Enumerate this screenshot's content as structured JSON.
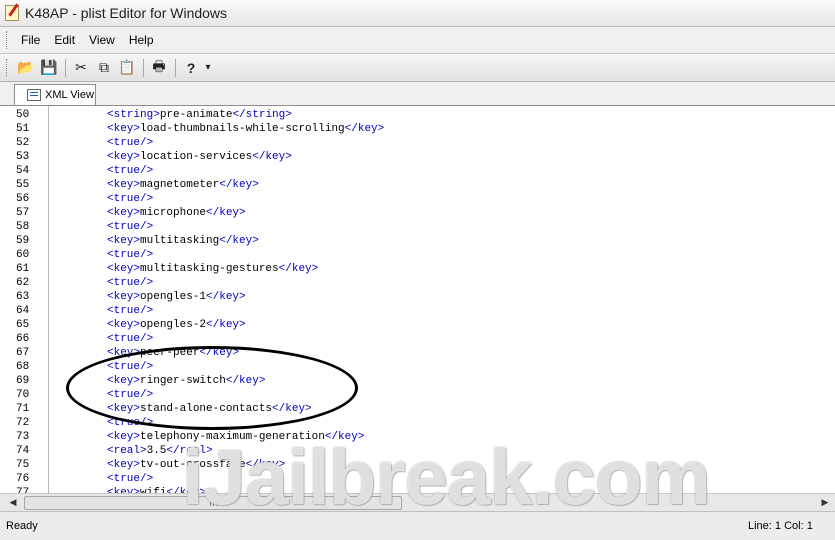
{
  "window": {
    "title": "K48AP - plist Editor for Windows"
  },
  "menu": [
    "File",
    "Edit",
    "View",
    "Help"
  ],
  "toolbar": {
    "buttons": [
      {
        "name": "open-icon",
        "glyph": "📂"
      },
      {
        "name": "save-icon",
        "glyph": "💾"
      },
      {
        "name": "cut-icon",
        "glyph": "✂"
      },
      {
        "name": "copy-icon",
        "glyph": "⧉"
      },
      {
        "name": "paste-icon",
        "glyph": "📋"
      },
      {
        "name": "print-icon",
        "glyph": "🖶"
      },
      {
        "name": "help-icon",
        "glyph": "?"
      }
    ],
    "dropdown_glyph": "▾"
  },
  "tabs": [
    {
      "label": "XML View"
    }
  ],
  "editor": {
    "lines": [
      {
        "n": "50",
        "tag": "string",
        "text": "pre-animate"
      },
      {
        "n": "51",
        "tag": "key",
        "text": "load-thumbnails-while-scrolling"
      },
      {
        "n": "52",
        "tag": "true/"
      },
      {
        "n": "53",
        "tag": "key",
        "text": "location-services"
      },
      {
        "n": "54",
        "tag": "true/"
      },
      {
        "n": "55",
        "tag": "key",
        "text": "magnetometer"
      },
      {
        "n": "56",
        "tag": "true/"
      },
      {
        "n": "57",
        "tag": "key",
        "text": "microphone"
      },
      {
        "n": "58",
        "tag": "true/"
      },
      {
        "n": "59",
        "tag": "key",
        "text": "multitasking"
      },
      {
        "n": "60",
        "tag": "true/"
      },
      {
        "n": "61",
        "tag": "key",
        "text": "multitasking-gestures"
      },
      {
        "n": "62",
        "tag": "true/"
      },
      {
        "n": "63",
        "tag": "key",
        "text": "opengles-1"
      },
      {
        "n": "64",
        "tag": "true/"
      },
      {
        "n": "65",
        "tag": "key",
        "text": "opengles-2"
      },
      {
        "n": "66",
        "tag": "true/"
      },
      {
        "n": "67",
        "tag": "key",
        "text": "peer-peer"
      },
      {
        "n": "68",
        "tag": "true/"
      },
      {
        "n": "69",
        "tag": "key",
        "text": "ringer-switch"
      },
      {
        "n": "70",
        "tag": "true/"
      },
      {
        "n": "71",
        "tag": "key",
        "text": "stand-alone-contacts"
      },
      {
        "n": "72",
        "tag": "true/"
      },
      {
        "n": "73",
        "tag": "key",
        "text": "telephony-maximum-generation"
      },
      {
        "n": "74",
        "tag": "real",
        "text": "3.5"
      },
      {
        "n": "75",
        "tag": "key",
        "text": "tv-out-crossfade"
      },
      {
        "n": "76",
        "tag": "true/"
      },
      {
        "n": "77",
        "tag": "key",
        "text": "wifi"
      }
    ]
  },
  "scrollbar": {
    "left_arrow": "◀",
    "right_arrow": "▶"
  },
  "status": {
    "text": "Ready",
    "position": "Line: 1 Col: 1"
  },
  "watermark": {
    "text": "iJailbreak.com"
  }
}
